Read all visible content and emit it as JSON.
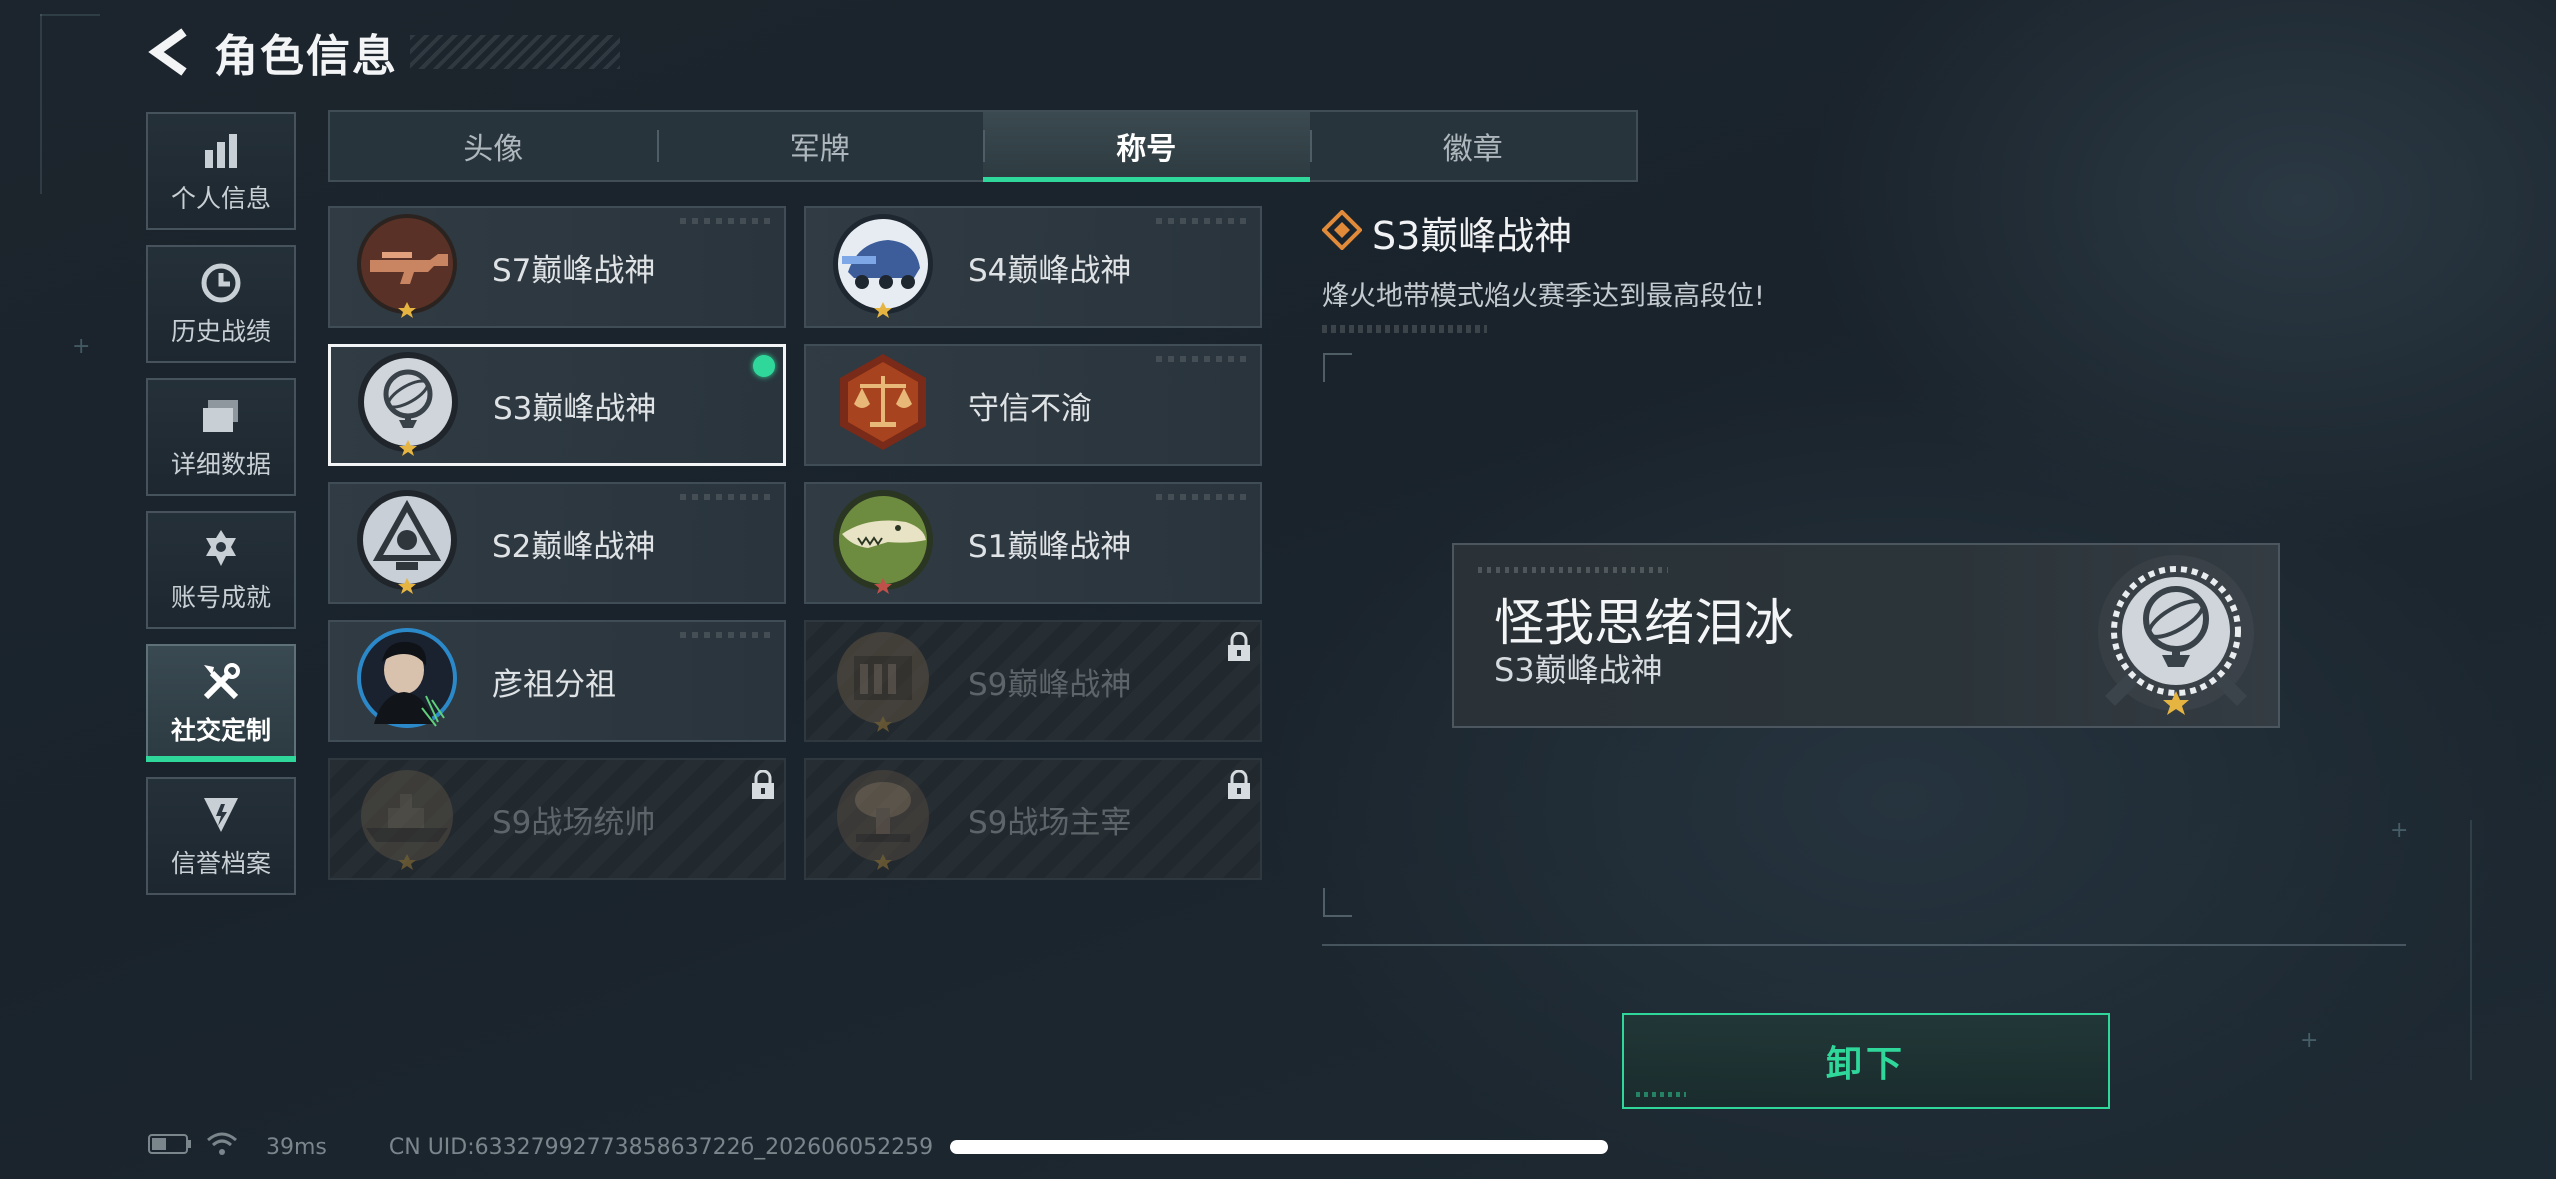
{
  "header": {
    "title": "角色信息"
  },
  "sidebar": {
    "items": [
      {
        "label": "个人信息",
        "icon": "bar-chart-icon"
      },
      {
        "label": "历史战绩",
        "icon": "clock-icon"
      },
      {
        "label": "详细数据",
        "icon": "folder-icon"
      },
      {
        "label": "账号成就",
        "icon": "achievement-icon"
      },
      {
        "label": "社交定制",
        "icon": "tools-icon",
        "active": true
      },
      {
        "label": "信誉档案",
        "icon": "shield-icon"
      }
    ]
  },
  "tabs": [
    {
      "label": "头像"
    },
    {
      "label": "军牌"
    },
    {
      "label": "称号",
      "active": true
    },
    {
      "label": "徽章"
    }
  ],
  "titles": [
    {
      "name": "S7巅峰战神",
      "emblem": "rifle-emblem",
      "locked": false
    },
    {
      "name": "S4巅峰战神",
      "emblem": "vehicle-emblem",
      "locked": false
    },
    {
      "name": "S3巅峰战神",
      "emblem": "globe-emblem",
      "locked": false,
      "selected": true,
      "equipped": true
    },
    {
      "name": "守信不渝",
      "emblem": "scales-emblem",
      "locked": false
    },
    {
      "name": "S2巅峰战神",
      "emblem": "triangle-emblem",
      "locked": false
    },
    {
      "name": "S1巅峰战神",
      "emblem": "crocodile-emblem",
      "locked": false
    },
    {
      "name": "彦祖分祖",
      "emblem": "portrait-emblem",
      "locked": false
    },
    {
      "name": "S9巅峰战神",
      "emblem": "building-emblem",
      "locked": true
    },
    {
      "name": "S9战场统帅",
      "emblem": "warship-emblem",
      "locked": true
    },
    {
      "name": "S9战场主宰",
      "emblem": "explosion-emblem",
      "locked": true
    }
  ],
  "detail": {
    "title": "S3巅峰战神",
    "description": "烽火地带模式焰火赛季达到最高段位!"
  },
  "preview": {
    "player_name": "怪我思绪泪冰",
    "title": "S3巅峰战神"
  },
  "actions": {
    "unequip_label": "卸下"
  },
  "status": {
    "ping": "39ms",
    "uid": "CN UID:6332799277385863722б_202606052259"
  },
  "colors": {
    "accent": "#2fd89a",
    "background": "#1c252d"
  }
}
